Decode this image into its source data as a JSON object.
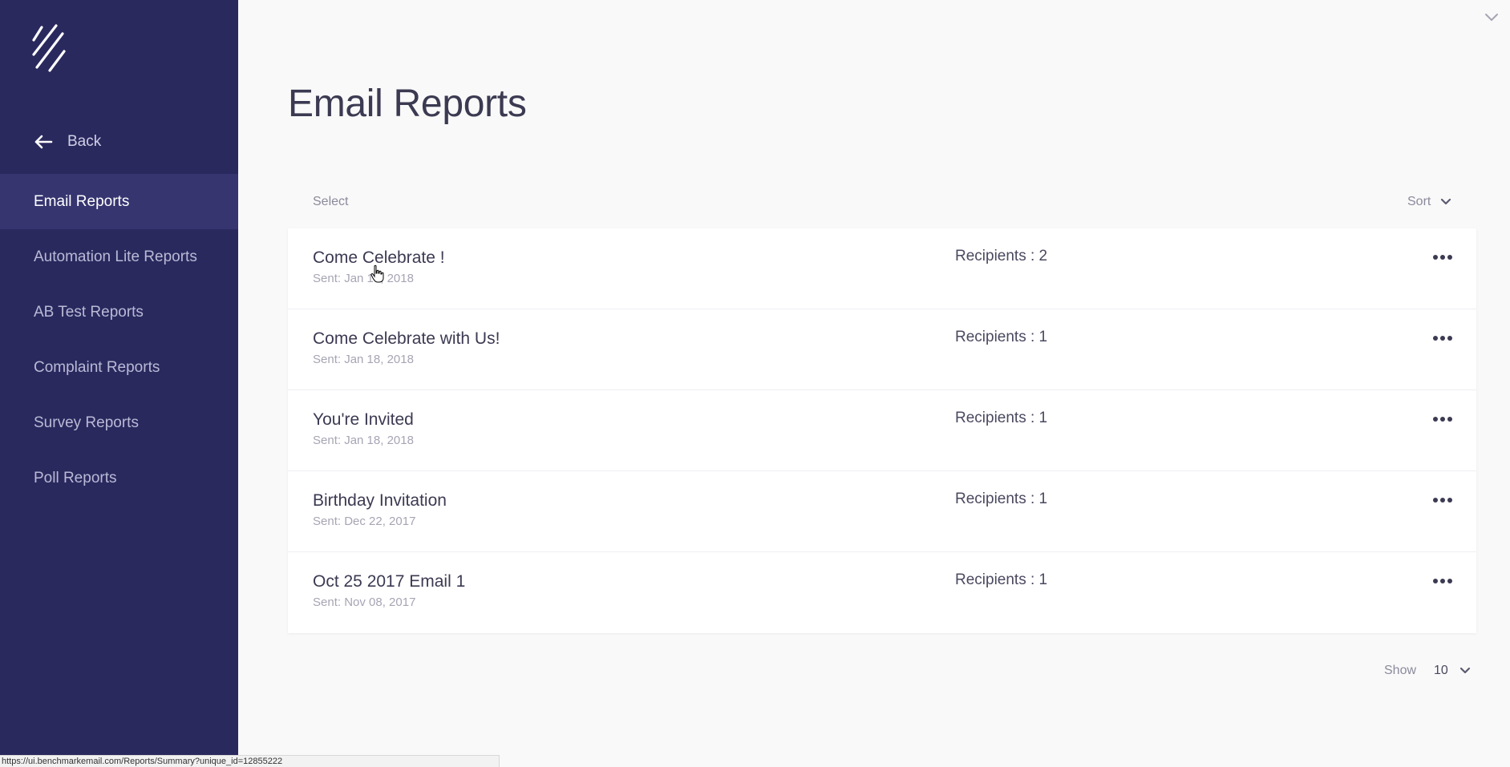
{
  "sidebar": {
    "back_label": "Back",
    "items": [
      {
        "label": "Email Reports",
        "active": true
      },
      {
        "label": "Automation Lite Reports"
      },
      {
        "label": "AB Test Reports"
      },
      {
        "label": "Complaint Reports"
      },
      {
        "label": "Survey Reports"
      },
      {
        "label": "Poll Reports"
      }
    ]
  },
  "main": {
    "title": "Email Reports",
    "select_label": "Select",
    "sort_label": "Sort",
    "reports": [
      {
        "name": "Come Celebrate !",
        "sent": "Sent: Jan 18, 2018",
        "recipients": "Recipients : 2"
      },
      {
        "name": "Come Celebrate with Us!",
        "sent": "Sent: Jan 18, 2018",
        "recipients": "Recipients : 1"
      },
      {
        "name": "You're Invited",
        "sent": "Sent: Jan 18, 2018",
        "recipients": "Recipients : 1"
      },
      {
        "name": "Birthday Invitation",
        "sent": "Sent: Dec 22, 2017",
        "recipients": "Recipients : 1"
      },
      {
        "name": "Oct 25 2017 Email 1",
        "sent": "Sent: Nov 08, 2017",
        "recipients": "Recipients : 1"
      }
    ],
    "show_label": "Show",
    "show_value": "10"
  },
  "statusbar": {
    "url": "https://ui.benchmarkemail.com/Reports/Summary?unique_id=12855222"
  },
  "colors": {
    "sidebar_bg": "#2a295e",
    "sidebar_active": "#363570",
    "page_bg": "#f9f9f9",
    "text_primary": "#3b3a52"
  },
  "icons": {
    "logo": "benchmark-logo-icon",
    "back": "arrow-left-icon",
    "sort": "chevron-down-icon",
    "more": "more-horizontal-icon"
  }
}
